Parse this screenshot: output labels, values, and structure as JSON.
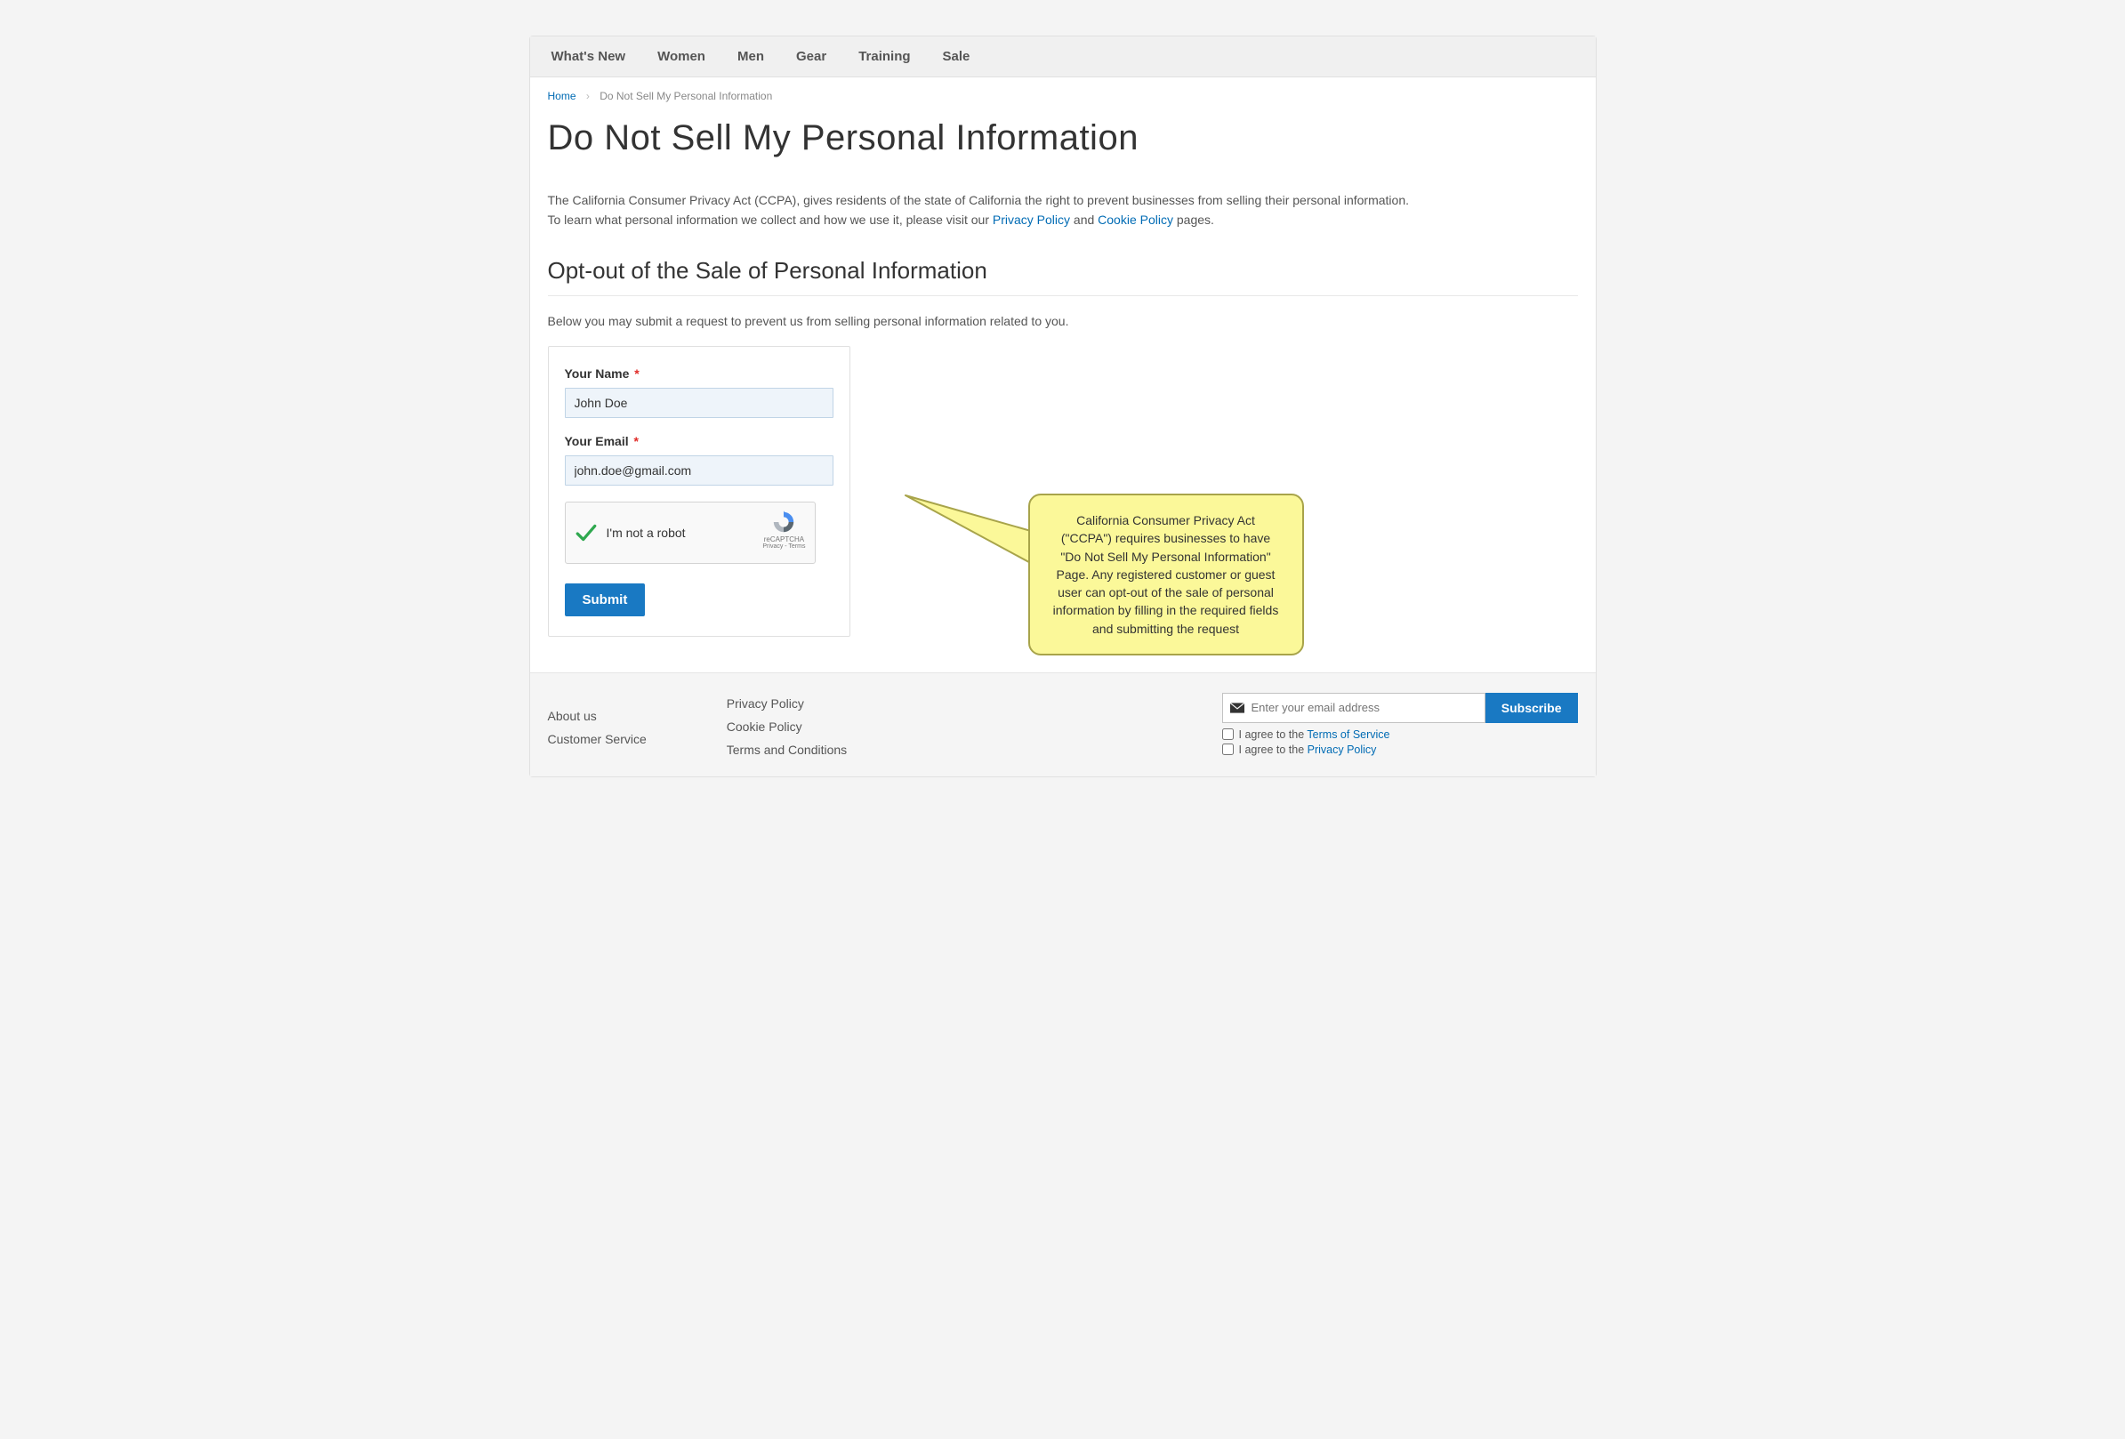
{
  "nav": {
    "items": [
      "What's New",
      "Women",
      "Men",
      "Gear",
      "Training",
      "Sale"
    ]
  },
  "breadcrumb": {
    "home": "Home",
    "current": "Do Not Sell My Personal Information"
  },
  "page": {
    "title": "Do Not Sell My Personal Information",
    "intro_line1": "The California Consumer Privacy Act (CCPA), gives residents of the state of California the right to prevent businesses from selling their personal information.",
    "intro_line2_prefix": "To learn what personal information we collect and how we use it, please visit our ",
    "privacy_link": "Privacy Policy",
    "intro_and": " and ",
    "cookie_link": "Cookie Policy",
    "intro_suffix": " pages.",
    "section_title": "Opt-out of the Sale of Personal Information",
    "form_desc": "Below you may submit a request to prevent us from selling personal information related to you."
  },
  "form": {
    "name_label": "Your Name",
    "name_value": "John Doe",
    "email_label": "Your Email",
    "email_value": "john.doe@gmail.com",
    "recaptcha_label": "I'm not a robot",
    "recaptcha_brand": "reCAPTCHA",
    "recaptcha_terms": "Privacy - Terms",
    "submit": "Submit"
  },
  "callout": {
    "text": "California Consumer Privacy Act (\"CCPA\") requires businesses to have \"Do Not Sell My Personal Information\" Page. Any registered customer or guest user can opt-out of the sale of personal information by filling in the required fields and submitting the request"
  },
  "footer": {
    "col1": [
      "About us",
      "Customer Service"
    ],
    "col2": [
      "Privacy Policy",
      "Cookie Policy",
      "Terms and Conditions"
    ],
    "subscribe_placeholder": "Enter your email address",
    "subscribe_btn": "Subscribe",
    "agree_tos_prefix": "I agree to the ",
    "agree_tos_link": "Terms of Service",
    "agree_pp_prefix": "I agree to the ",
    "agree_pp_link": "Privacy Policy"
  }
}
